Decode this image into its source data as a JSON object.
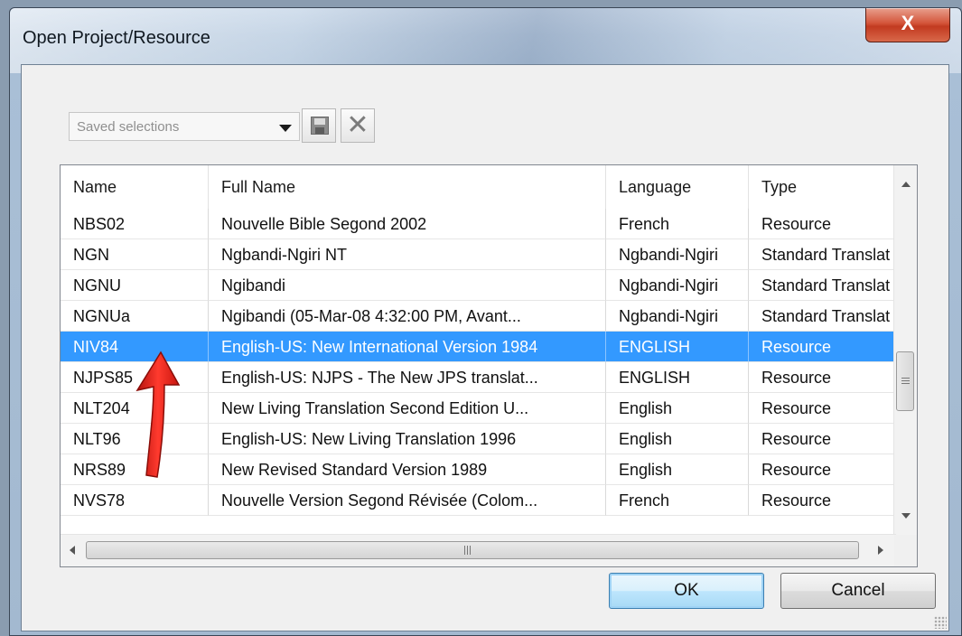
{
  "window": {
    "title": "Open Project/Resource",
    "close_glyph": "X"
  },
  "saved_selections": {
    "placeholder": "Saved selections",
    "icons": [
      "save-icon",
      "delete-icon"
    ]
  },
  "grid": {
    "columns": [
      "Name",
      "Full Name",
      "Language",
      "Type"
    ],
    "rows": [
      {
        "name": "NBS02",
        "full_name": "Nouvelle Bible Segond 2002",
        "language": "French",
        "type": "Resource"
      },
      {
        "name": "NGN",
        "full_name": "Ngbandi-Ngiri NT",
        "language": "Ngbandi-Ngiri",
        "type": "Standard Translat"
      },
      {
        "name": "NGNU",
        "full_name": "Ngibandi",
        "language": "Ngbandi-Ngiri",
        "type": "Standard Translat"
      },
      {
        "name": "NGNUa",
        "full_name": "Ngibandi (05-Mar-08  4:32:00 PM,  Avant...",
        "language": "Ngbandi-Ngiri",
        "type": "Standard Translat"
      },
      {
        "name": "NIV84",
        "full_name": "English-US: New International Version 1984",
        "language": "ENGLISH",
        "type": "Resource"
      },
      {
        "name": "NJPS85",
        "full_name": "English-US: NJPS - The New JPS translat...",
        "language": "ENGLISH",
        "type": "Resource"
      },
      {
        "name": "NLT204",
        "full_name": "New Living Translation Second Edition U...",
        "language": "English",
        "type": "Resource"
      },
      {
        "name": "NLT96",
        "full_name": "English-US: New Living Translation 1996",
        "language": "English",
        "type": "Resource"
      },
      {
        "name": "NRS89",
        "full_name": "New Revised Standard Version 1989",
        "language": "English",
        "type": "Resource"
      },
      {
        "name": "NVS78",
        "full_name": "Nouvelle Version Segond Révisée (Colom...",
        "language": "French",
        "type": "Resource"
      }
    ],
    "selected_index": 4
  },
  "buttons": {
    "ok": "OK",
    "cancel": "Cancel"
  },
  "colors": {
    "selection": "#3399ff",
    "annotation_arrow": "#e8261e",
    "close_button": "#c8452c"
  }
}
